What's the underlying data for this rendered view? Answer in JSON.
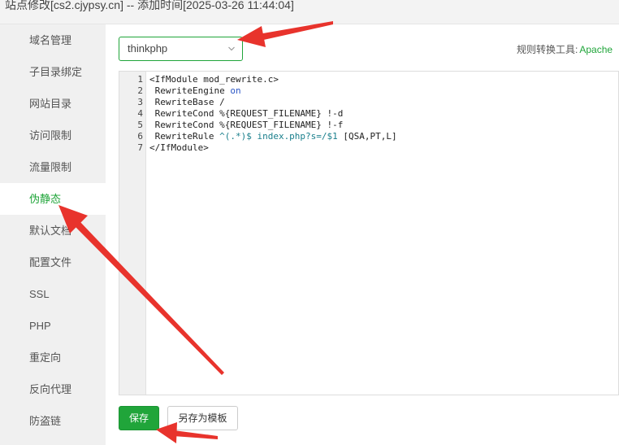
{
  "window": {
    "title": "站点修改[cs2.cjypsy.cn] -- 添加时间[2025-03-26 11:44:04]"
  },
  "sidebar": {
    "items": [
      {
        "label": "域名管理"
      },
      {
        "label": "子目录绑定"
      },
      {
        "label": "网站目录"
      },
      {
        "label": "访问限制"
      },
      {
        "label": "流量限制"
      },
      {
        "label": "伪静态",
        "active": true
      },
      {
        "label": "默认文档"
      },
      {
        "label": "配置文件"
      },
      {
        "label": "SSL"
      },
      {
        "label": "PHP"
      },
      {
        "label": "重定向"
      },
      {
        "label": "反向代理"
      },
      {
        "label": "防盗链"
      }
    ]
  },
  "rewrite": {
    "selected_template": "thinkphp",
    "tool_label": "规则转换工具:",
    "tool_link": "Apache"
  },
  "editor": {
    "lines": [
      {
        "num": "1",
        "text": "<IfModule mod_rewrite.c>"
      },
      {
        "num": "2",
        "text": " RewriteEngine on"
      },
      {
        "num": "3",
        "text": " RewriteBase /"
      },
      {
        "num": "4",
        "text": " RewriteCond %{REQUEST_FILENAME} !-d"
      },
      {
        "num": "5",
        "text": " RewriteCond %{REQUEST_FILENAME} !-f"
      },
      {
        "num": "6",
        "text": " RewriteRule ^(.*)$ index.php?s=/$1 [QSA,PT,L]"
      },
      {
        "num": "7",
        "text": "</IfModule>"
      }
    ]
  },
  "actions": {
    "save_label": "保存",
    "save_as_template_label": "另存为模板"
  },
  "colors": {
    "accent": "#20a53a",
    "annotation_arrow": "#e8332c"
  }
}
